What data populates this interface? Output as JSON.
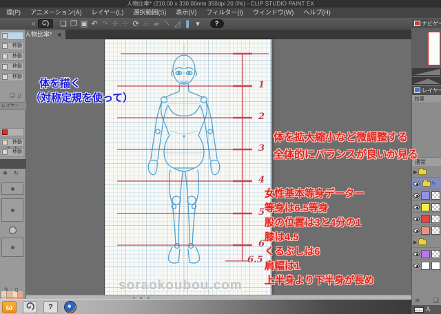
{
  "window": {
    "title": "人物比率* (210.00 x 330.00mm 350dpi 20.0%) - CLIP STUDIO PAINT EX"
  },
  "menu": {
    "items": [
      "理(P)",
      "アニメーション(A)",
      "レイヤー(L)",
      "選択範囲(S)",
      "表示(V)",
      "フィルター(I)",
      "ウィンドウ(W)",
      "ヘルプ(H)"
    ]
  },
  "toolbar": {
    "collapse_glyph": "«",
    "expand_glyph": "« »",
    "icons": [
      "❏",
      "❐",
      "▣",
      "↶",
      "↷",
      "✛",
      "⊹",
      "⟳",
      "⟍",
      "◿",
      "❚",
      "▾"
    ],
    "help_glyph": "?"
  },
  "document_tab": {
    "label": "人物比率*"
  },
  "canvas": {
    "ruler_labels": [
      "1",
      "2",
      "3",
      "4",
      "5",
      "6",
      "6.5"
    ],
    "watermark": "soraokoubou.com",
    "notes": {
      "blue_line1": "体を描く",
      "blue_line2": "（対称定規を使って）",
      "red_top_line1": "体を拡大縮小など微調整する",
      "red_top_line2": "全体的にバランスが良いか見る",
      "red_list_title": "女性基本等身データー",
      "red_list_items": [
        "等身は6.5等身",
        "股の位置は3と4分の1",
        "膝は4.5",
        "くるぶしは6",
        "肩幅は1",
        "上半身より下半身が長め"
      ]
    }
  },
  "left_dock": {
    "tool_rows": [
      "移動",
      "移動",
      "移動",
      "移動"
    ],
    "layer_label": "レイヤー",
    "sub_rows": [
      "移動",
      "移動"
    ],
    "palette": [
      "#ecd2b4",
      "#e4bc96",
      "#f2dcc4",
      "#dcae8e",
      "#f2c4aa",
      "#ea967e",
      "#f2a48c",
      "#ea846c",
      "#e84444",
      "#d23434",
      "#f05c5c",
      "#ca2c2c"
    ]
  },
  "right_dock": {
    "navigator_title": "ナビゲー",
    "layer_property_title": "レイヤー",
    "effect_label": "効果",
    "blend_label": "通常",
    "layer_colors": [
      "#9092e8",
      "#f6ee4a",
      "#e64545",
      "#f2927e",
      "#bf72ee",
      "#ffffff"
    ],
    "status_letter": "A"
  },
  "colors": {
    "accent_red": "#c84452",
    "sketch_blue": "#4da3d4",
    "note_red": "#e3241d",
    "note_blue": "#1b16d9"
  }
}
